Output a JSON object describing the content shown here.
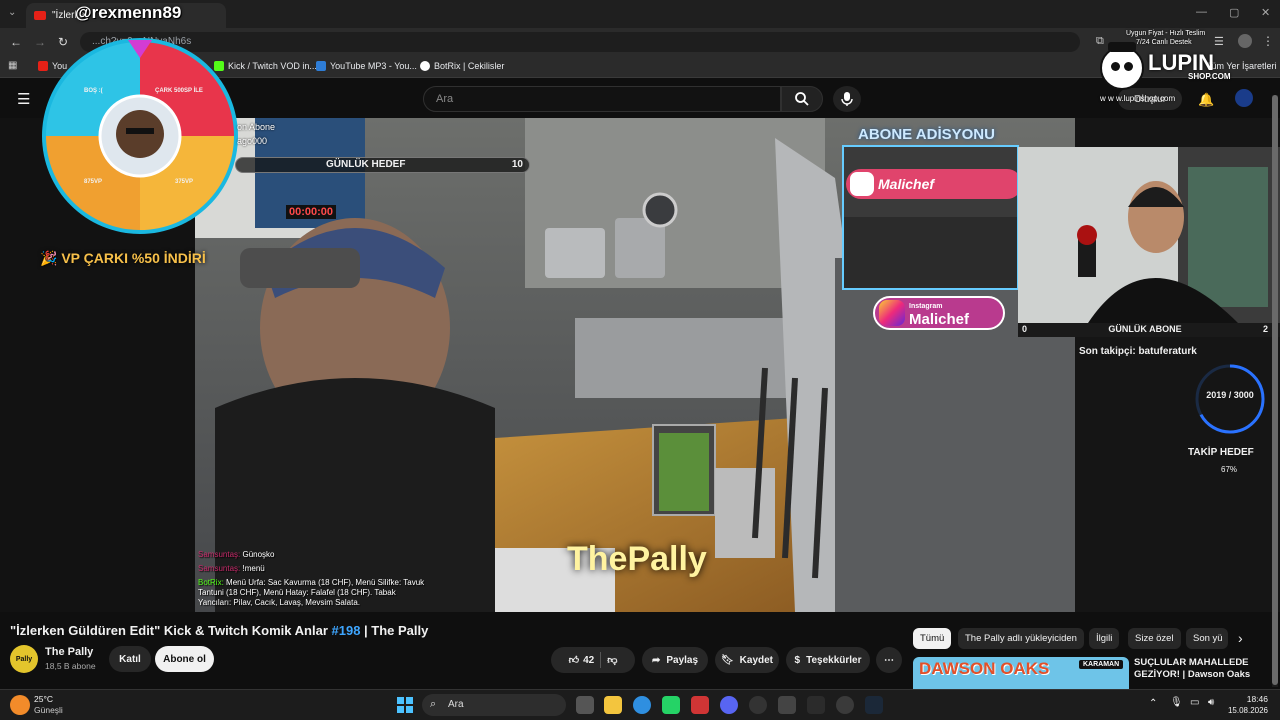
{
  "browser": {
    "tab_title": "\"İzlerke",
    "overlay_handle": "@rexmenn89",
    "url": "...ch?v=9vxNNyaNh6s",
    "bookmarks": [
      "You",
      "Kick / Twitch VOD in...",
      "YouTube MP3 - You...",
      "BotRix | Cekilisler",
      "Tüm Yer İşaretleri"
    ],
    "promo_line1": "Uygun Fiyat - Hızlı Teslim",
    "promo_line2": "7/24 Canlı Destek",
    "lupin_brand": "LUPIN",
    "lupin_sub": "SHOP.COM",
    "lupin_url": "w w w.lupinshop.com"
  },
  "youtube": {
    "search_placeholder": "Ara",
    "create_label": "Oluştur"
  },
  "stream_overlay": {
    "wheel_labels": [
      "BOŞ :(",
      "ÇARK 500SP İLE",
      "875VP",
      "375VP"
    ],
    "vp_cark_text": "🎉 VP ÇARKI %50 İNDİRİ",
    "abone_text": "on Abone",
    "abone_user": "ago000",
    "daily_goal_label": "GÜNLÜK HEDEF",
    "daily_goal_value": "10",
    "timer": "00:00:00",
    "abone_adisyonu": "ABONE ADİSYONU",
    "ig_label": "Instagram",
    "ig_name": "Malichef",
    "daily_sub_label": "GÜNLÜK ABONE",
    "daily_sub_left": "0",
    "daily_sub_right": "2",
    "last_follower": "Son takipçi: batuferaturk",
    "follow_count": "2019 / 3000",
    "follow_goal_label": "TAKİP HEDEF",
    "follow_pct": "67%",
    "follow_fraction": 0.67,
    "watermark": "ThePally",
    "chat": [
      {
        "user": "Samsuntaş:",
        "msg": "Günoşko"
      },
      {
        "user": "Samsuntaş:",
        "msg": "!menü"
      },
      {
        "user": "BotRix:",
        "msg": "Menü Urfa: Sac Kavurma (18 CHF), Menü Silifke: Tavuk Tantuni (18 CHF), Menü Hatay: Falafel (18 CHF). Tabak Yancıları: Pilav, Cacık, Lavaş, Mevsim Salata."
      }
    ]
  },
  "video_info": {
    "title_main": "\"İzlerken Güldüren Edit\" Kick & Twitch Komik Anlar ",
    "title_tag": "#198",
    "title_end": " | The Pally",
    "channel": "The Pally",
    "subs": "18,5 B abone",
    "join_label": "Katıl",
    "subscribe_label": "Abone ol",
    "likes": "42",
    "share_label": "Paylaş",
    "save_label": "Kaydet",
    "thanks_label": "Teşekkürler",
    "more_label": "⋯"
  },
  "sidebar": {
    "chips": [
      "Tümü",
      "The Pally adlı yükleyiciden",
      "İlgili",
      "Size özel",
      "Son yü"
    ],
    "rec_title": "SUÇLULAR MAHALLEDE GEZİYOR! | Dawson Oaks",
    "rec_thumb_text": "DAWSON OAKS",
    "rec_badge": "KARAMAN"
  },
  "taskbar": {
    "temp": "25°C",
    "weather": "Güneşli",
    "search": "Ara",
    "time": "18:46",
    "date": "15.08.2026"
  },
  "colors": {
    "yt_red": "#e62117",
    "link_blue": "#3ea6ff",
    "wheel_red": "#e8354b",
    "wheel_cyan": "#2ec4e6",
    "wheel_orange": "#f0a030",
    "overlay_gold": "#f7c04a"
  }
}
